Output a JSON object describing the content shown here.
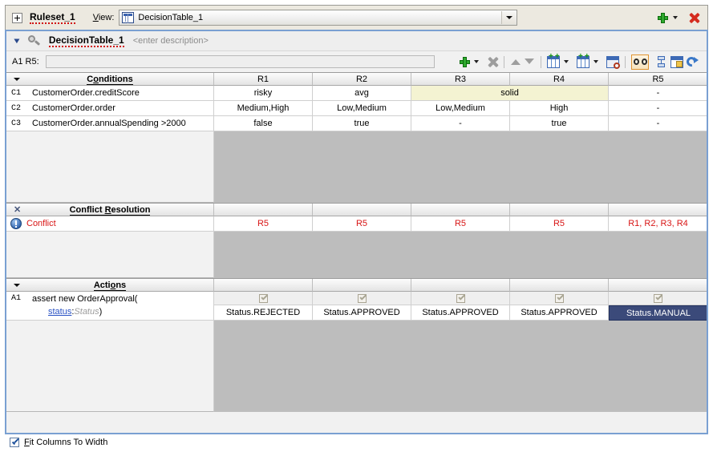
{
  "window": {
    "ruleset_name": "Ruleset_1",
    "expand_icon": "plus-box-icon",
    "view_label_pre": "V",
    "view_label_post": "iew:",
    "view_value": "DecisionTable_1",
    "view_icon": "decision-table-icon",
    "add_ruleset_icon": "green-plus-icon",
    "delete_ruleset_icon": "red-x-icon"
  },
  "decision_table": {
    "collapse_icon": "double-chevron-icon",
    "search_icon": "magnifier-icon",
    "title": "DecisionTable_1",
    "description_placeholder": "<enter description>",
    "cell_reference": "A1 R5:",
    "formula_value": "",
    "toolbar": [
      {
        "name": "add-icon",
        "label": "Add",
        "has_dropdown": true,
        "state": "enabled"
      },
      {
        "name": "delete-icon",
        "label": "Delete",
        "has_dropdown": false,
        "state": "disabled"
      },
      {
        "name": "move-up-icon",
        "label": "Move Up",
        "has_dropdown": false,
        "state": "disabled"
      },
      {
        "name": "move-down-icon",
        "label": "Move Down",
        "has_dropdown": false,
        "state": "disabled"
      },
      {
        "name": "split-table-icon",
        "label": "Split Table",
        "has_dropdown": true,
        "state": "enabled"
      },
      {
        "name": "merge-table-icon",
        "label": "Merge Table",
        "has_dropdown": true,
        "state": "enabled"
      },
      {
        "name": "analyze-table-icon",
        "label": "Analyze Table",
        "has_dropdown": false,
        "state": "enabled"
      },
      {
        "name": "show-conflicts-icon",
        "label": "Show Conflicts",
        "has_dropdown": false,
        "state": "toggled-on"
      },
      {
        "name": "compact-table-icon",
        "label": "Compact",
        "has_dropdown": false,
        "state": "enabled"
      },
      {
        "name": "table-properties-icon",
        "label": "Properties",
        "has_dropdown": false,
        "state": "enabled"
      },
      {
        "name": "refresh-icon",
        "label": "Refresh",
        "has_dropdown": false,
        "state": "enabled"
      }
    ]
  },
  "rules": [
    "R1",
    "R2",
    "R3",
    "R4",
    "R5"
  ],
  "conditions": {
    "section_title": "Conditions",
    "section_title_pre": "C",
    "section_title_mnemonic": "o",
    "section_title_post": "nditions",
    "rows": [
      {
        "id": "C1",
        "expression": "CustomerOrder.creditScore",
        "cells": [
          {
            "value": "risky",
            "span": 1,
            "highlight": false
          },
          {
            "value": "avg",
            "span": 1,
            "highlight": false
          },
          {
            "value": "solid",
            "span": 2,
            "highlight": true
          },
          {
            "value": "-",
            "span": 1,
            "highlight": false
          }
        ]
      },
      {
        "id": "C2",
        "expression": "CustomerOrder.order",
        "cells": [
          {
            "value": "Medium,High",
            "span": 1,
            "highlight": false
          },
          {
            "value": "Low,Medium",
            "span": 1,
            "highlight": false
          },
          {
            "value": "Low,Medium",
            "span": 1,
            "highlight": false
          },
          {
            "value": "High",
            "span": 1,
            "highlight": false
          },
          {
            "value": "-",
            "span": 1,
            "highlight": false
          }
        ]
      },
      {
        "id": "C3",
        "expression": "CustomerOrder.annualSpending >2000",
        "cells": [
          {
            "value": "false",
            "span": 1,
            "highlight": false
          },
          {
            "value": "true",
            "span": 1,
            "highlight": false
          },
          {
            "value": "-",
            "span": 1,
            "highlight": false
          },
          {
            "value": "true",
            "span": 1,
            "highlight": false
          },
          {
            "value": "-",
            "span": 1,
            "highlight": false
          }
        ]
      }
    ]
  },
  "conflict_resolution": {
    "section_title_pre": "Conflict ",
    "section_title_mnemonic": "R",
    "section_title_post": "esolution",
    "close_icon": "close-x-icon",
    "row_icon": "conflict-warning-icon",
    "row_label": "Conflict",
    "values": [
      "R5",
      "R5",
      "R5",
      "R5",
      "R1, R2, R3, R4"
    ]
  },
  "actions": {
    "section_title_pre": "Acti",
    "section_title_mnemonic": "o",
    "section_title_post": "ns",
    "row_id": "A1",
    "line1": "assert new OrderApproval(",
    "param_name": "status",
    "param_sep": ":",
    "param_type": "Status",
    "param_close": ")",
    "checkboxes": [
      true,
      true,
      true,
      true,
      true
    ],
    "values": [
      "Status.REJECTED",
      "Status.APPROVED",
      "Status.APPROVED",
      "Status.APPROVED",
      "Status.MANUAL"
    ],
    "selected_index": 4
  },
  "footer": {
    "fit_columns_checked": true,
    "fit_columns_pre": "F",
    "fit_columns_post": "it Columns To Width"
  },
  "colors": {
    "accent_blue": "#7aa0d2",
    "selection_navy": "#3b4a7a",
    "conflict_red": "#d81515",
    "span_highlight": "#f4f3d2",
    "panel_gray": "#bdbdbd"
  }
}
